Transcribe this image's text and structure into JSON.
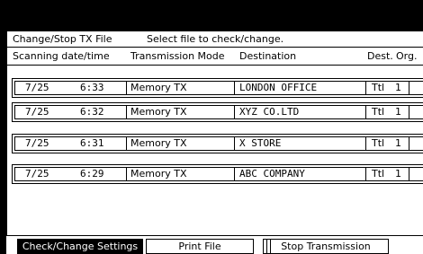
{
  "window": {
    "title": "Change/Stop TX File",
    "instruction": "Select file to check/change."
  },
  "columns": {
    "scanning": "Scanning date/time",
    "mode": "Transmission Mode",
    "destination": "Destination",
    "dest": "Dest.",
    "org": "Org."
  },
  "rows": [
    {
      "date": "7/25",
      "time": "6:33",
      "mode": "Memory TX",
      "destination": "LONDON OFFICE",
      "dest": "Ttl",
      "org": "1"
    },
    {
      "date": "7/25",
      "time": "6:32",
      "mode": "Memory TX",
      "destination": "XYZ CO.LTD",
      "dest": "Ttl",
      "org": "1"
    },
    {
      "date": "7/25",
      "time": "6:31",
      "mode": "Memory TX",
      "destination": "X STORE",
      "dest": "Ttl",
      "org": "1"
    },
    {
      "date": "7/25",
      "time": "6:29",
      "mode": "Memory TX",
      "destination": "ABC COMPANY",
      "dest": "Ttl",
      "org": "1"
    }
  ],
  "buttons": {
    "check_change": "Check/Change Settings",
    "print_file": "Print File",
    "stop_transmission": "Stop Transmission"
  },
  "colors": {
    "background": "#000000",
    "panel": "#ffffff",
    "selected_button": "#000000"
  }
}
